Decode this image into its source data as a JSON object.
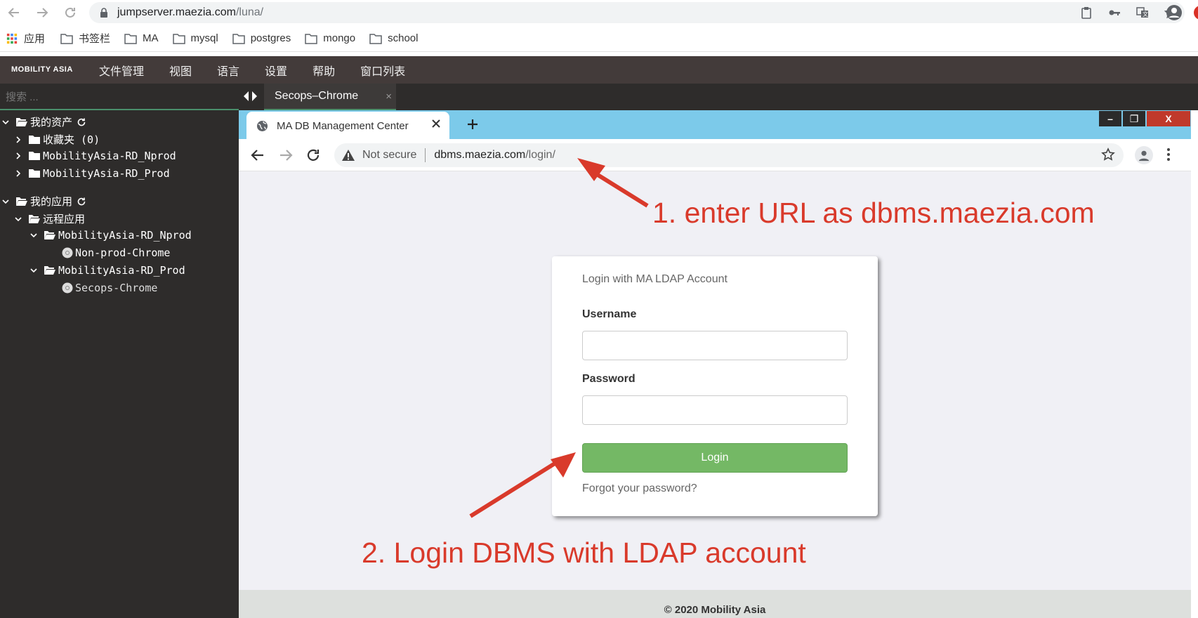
{
  "browser": {
    "url_host": "jumpserver.maezia.com",
    "url_path": "/luna/"
  },
  "bookmarks": [
    {
      "label": "应用",
      "icon": "apps-grid-icon"
    },
    {
      "label": "书签栏",
      "icon": "folder-icon"
    },
    {
      "label": "MA",
      "icon": "folder-icon"
    },
    {
      "label": "mysql",
      "icon": "folder-icon"
    },
    {
      "label": "postgres",
      "icon": "folder-icon"
    },
    {
      "label": "mongo",
      "icon": "folder-icon"
    },
    {
      "label": "school",
      "icon": "folder-icon"
    }
  ],
  "app": {
    "logo": "MOBILITY ASIA",
    "menu": [
      "文件管理",
      "视图",
      "语言",
      "设置",
      "帮助",
      "窗口列表"
    ]
  },
  "sidebar": {
    "search_placeholder": "搜索 ...",
    "tree": {
      "assets": "我的资产",
      "favorites": "收藏夹 (0)",
      "rd_nprod": "MobilityAsia-RD_Nprod",
      "rd_prod": "MobilityAsia-RD_Prod",
      "apps": "我的应用",
      "remote_apps": "远程应用",
      "app_nprod": "MobilityAsia-RD_Nprod",
      "nonprod_chrome": "Non-prod-Chrome",
      "app_prod": "MobilityAsia-RD_Prod",
      "secops_chrome": "Secops-Chrome"
    }
  },
  "session_tab": {
    "label": "Secops–Chrome",
    "close": "×"
  },
  "remote": {
    "tab_title": "MA DB Management Center",
    "not_secure": "Not secure",
    "url_host": "dbms.maezia.com",
    "url_path": "/login/",
    "window_buttons": [
      "–",
      "❐",
      "X"
    ]
  },
  "login": {
    "title": "Login with MA LDAP Account",
    "username_label": "Username",
    "username_value": "",
    "password_label": "Password",
    "password_value": "",
    "button": "Login",
    "forgot": "Forgot your password?"
  },
  "footer": "© 2020 Mobility Asia",
  "annotations": {
    "step1": "1. enter URL as dbms.maezia.com",
    "step2": "2. Login DBMS with LDAP account",
    "color": "#d93a2b"
  }
}
